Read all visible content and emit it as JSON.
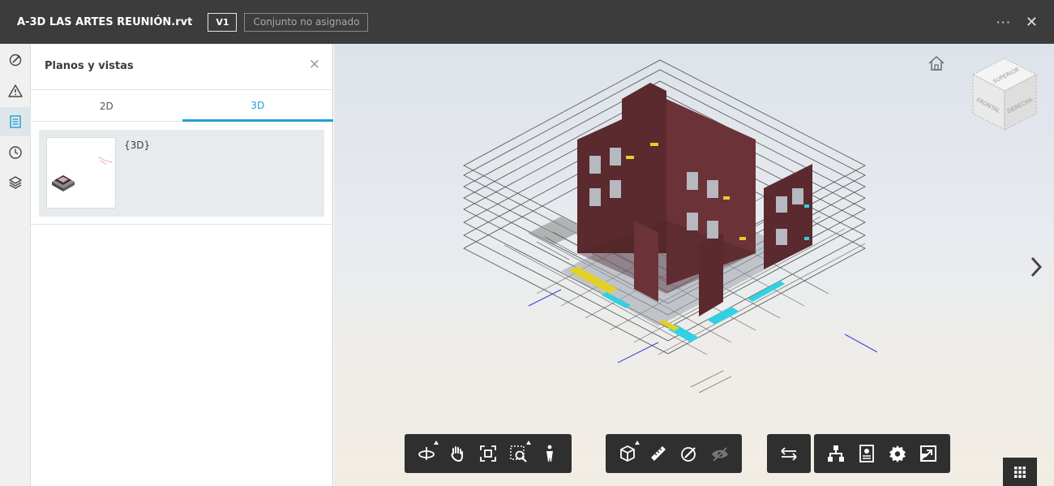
{
  "header": {
    "file_name": "A-3D LAS ARTES REUNIÓN.rvt",
    "version": "V1",
    "set_status": "Conjunto no asignado",
    "more_label": "···",
    "close_label": "✕"
  },
  "rail": {
    "items": [
      {
        "icon": "markup-icon",
        "active": false
      },
      {
        "icon": "issues-warning-icon",
        "active": false
      },
      {
        "icon": "sheets-views-icon",
        "active": true
      },
      {
        "icon": "history-clock-icon",
        "active": false
      },
      {
        "icon": "layers-icon",
        "active": false
      }
    ]
  },
  "panel": {
    "title": "Planos y vistas",
    "close_label": "✕",
    "tabs": [
      {
        "label": "2D",
        "active": false
      },
      {
        "label": "3D",
        "active": true
      }
    ],
    "views": [
      {
        "name": "{3D}"
      }
    ]
  },
  "viewcube": {
    "top": "SUPERIOR",
    "front": "FRONTAL",
    "right": "DERECHA"
  },
  "toolbar": {
    "groups": [
      [
        "orbit-icon",
        "pan-hand-icon",
        "fit-to-view-icon",
        "zoom-window-icon",
        "first-person-icon"
      ],
      [
        "section-box-icon",
        "measure-icon",
        "markup-pen-icon",
        "hide-eye-icon"
      ],
      [
        "compare-arrows-icon"
      ],
      [
        "model-browser-icon",
        "properties-icon",
        "settings-gear-icon",
        "fullscreen-icon"
      ]
    ]
  },
  "colors": {
    "accent": "#1e9fd6",
    "topbar": "#3c3c3c",
    "toolbar": "#2f2f2f",
    "wall": "#5a2a2e"
  }
}
